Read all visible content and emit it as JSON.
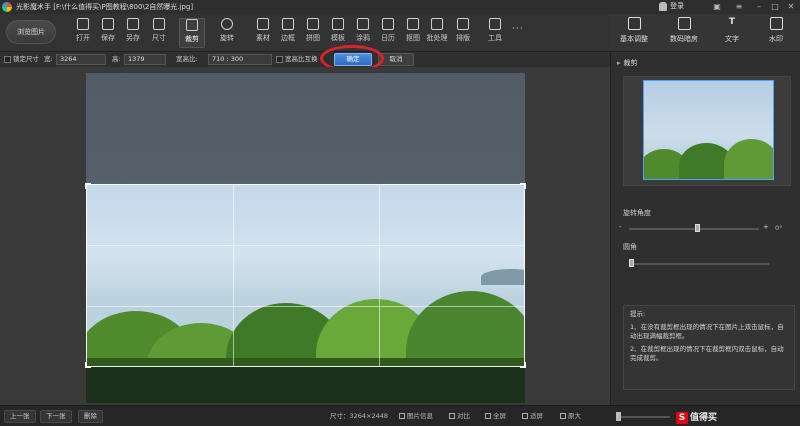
{
  "window": {
    "title": "光影魔术手 [F:\\什么值得买\\P图教程\\800\\2自然曝光.jpg]",
    "login_label": "登录"
  },
  "toolbar": {
    "browse_label": "浏览图片",
    "tools": [
      "打开",
      "保存",
      "另存",
      "尺寸",
      "裁剪",
      "旋转",
      "素材",
      "边框",
      "拼图",
      "模板",
      "涂鸦",
      "日历",
      "抠图",
      "批处理",
      "排版",
      "工具"
    ],
    "active_tool": "裁剪",
    "more_label": "···"
  },
  "right_tools": [
    {
      "label": "基本调整",
      "icon": "adjust-icon"
    },
    {
      "label": "数码暗房",
      "icon": "camera-icon"
    },
    {
      "label": "文字",
      "icon": "text-icon",
      "glyph": "T"
    },
    {
      "label": "水印",
      "icon": "watermark-icon"
    }
  ],
  "cropbar": {
    "lock_size_label": "锁定尺寸",
    "width_label": "宽:",
    "width_value": "3264",
    "height_label": "高:",
    "height_value": "1379",
    "ratio_label": "宽高比:",
    "ratio_value": "710 : 300",
    "swap_label": "宽高比互换",
    "ok_label": "确定",
    "cancel_label": "取消"
  },
  "panel": {
    "title": "裁剪",
    "rotate_label": "旋转角度",
    "rotate_min": "-",
    "rotate_plus": "+",
    "rotate_value": "0°",
    "corner_label": "圆角",
    "tips_title": "提示:",
    "tips": [
      "1、在没有裁剪框出现的情况下在图片上双击鼠标，自动出现满幅裁剪框。",
      "2、在裁剪框出现的情况下在裁剪框内双击鼠标，自动完成裁剪。"
    ]
  },
  "status": {
    "prev_label": "上一张",
    "next_label": "下一张",
    "delete_label": "删除",
    "size_text": "尺寸：3264×2448",
    "info_label": "图片信息",
    "compare_label": "对比",
    "fullscreen_label": "全屏",
    "fit_label": "适屏",
    "original_label": "原大",
    "brand_text": "值得买"
  },
  "colors": {
    "accent": "#2f6cc0",
    "highlight_ring": "#d9232d",
    "background": "#2b2b2b"
  }
}
